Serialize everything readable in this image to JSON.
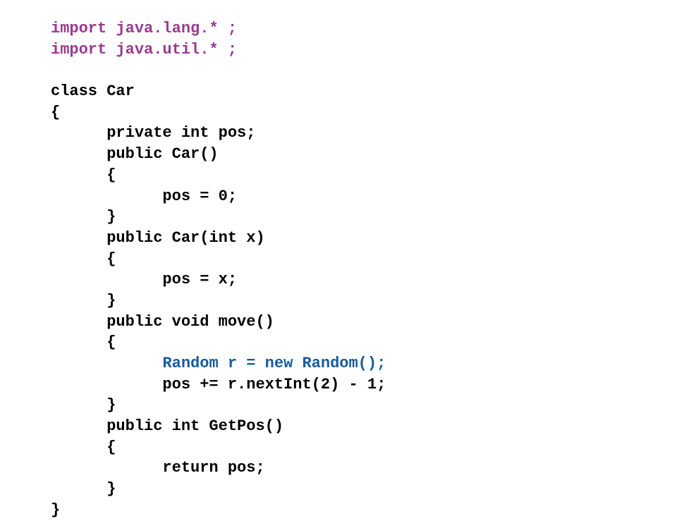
{
  "code": {
    "import1": "import java.lang.* ;",
    "import2": "import java.util.* ;",
    "classDecl": "class Car",
    "open": "{",
    "close": "}",
    "field": "      private int pos;",
    "ctor0_sig": "      public Car()",
    "ctor0_open": "      {",
    "ctor0_body": "            pos = 0;",
    "ctor0_close": "      }",
    "ctor1_sig": "      public Car(int x)",
    "ctor1_open": "      {",
    "ctor1_body": "            pos = x;",
    "ctor1_close": "      }",
    "move_sig": "      public void move()",
    "move_open": "      {",
    "move_indent": "            ",
    "move_rand": "Random r = new Random();",
    "move_pos": "            pos += r.nextInt(2) - 1;",
    "move_close": "      }",
    "get_sig": "      public int GetPos()",
    "get_open": "      {",
    "get_body": "            return pos;",
    "get_close": "      }"
  }
}
